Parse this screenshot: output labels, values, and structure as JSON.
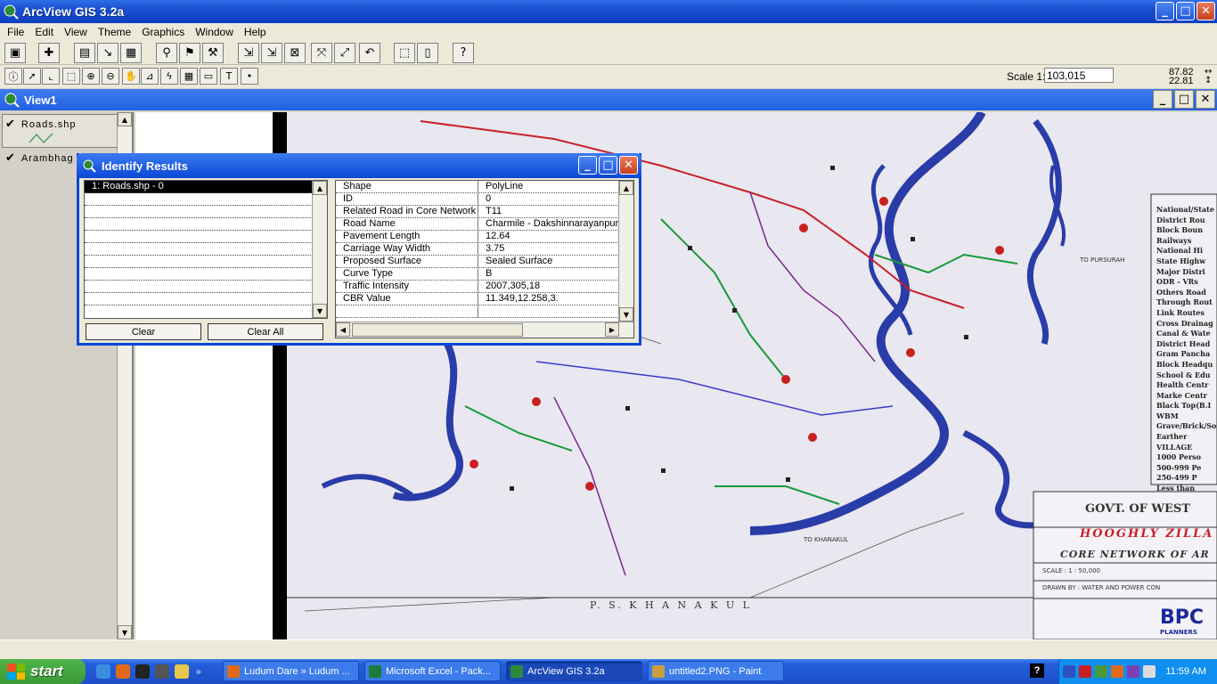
{
  "app": {
    "title": "ArcView GIS 3.2a"
  },
  "menu": [
    "File",
    "Edit",
    "View",
    "Theme",
    "Graphics",
    "Window",
    "Help"
  ],
  "scale": {
    "label": "Scale 1:",
    "value": "103,015"
  },
  "coords": {
    "x": "87.82",
    "y": "22.81"
  },
  "view": {
    "title": "View1"
  },
  "toc": [
    {
      "label": "Roads.shp",
      "checked": true
    },
    {
      "label": "Arambhag",
      "checked": true
    }
  ],
  "identify": {
    "title": "Identify Results",
    "results": [
      "1:  Roads.shp - 0"
    ],
    "attributes": [
      {
        "key": "Shape",
        "value": "PolyLine"
      },
      {
        "key": "ID",
        "value": "0"
      },
      {
        "key": "Related Road in Core Network",
        "value": "T11"
      },
      {
        "key": "Road Name",
        "value": "Charmile - Dakshinnarayanpur"
      },
      {
        "key": "Pavement Length",
        "value": "12.64"
      },
      {
        "key": "Carriage Way Width",
        "value": "3.75"
      },
      {
        "key": "Proposed Surface",
        "value": "Sealed Surface"
      },
      {
        "key": "Curve Type",
        "value": "B"
      },
      {
        "key": "Traffic Intensity",
        "value": "2007,305,18"
      },
      {
        "key": "CBR Value",
        "value": "11.349,12.258,3."
      }
    ],
    "clear_label": "Clear",
    "clear_all_label": "Clear All"
  },
  "map": {
    "labels": {
      "govt": "GOVT. OF WEST",
      "zilla": "HOOGHLY ZILLA",
      "core": "CORE NETWORK OF AR",
      "scale_txt": "SCALE : 1 : 50,000",
      "drawn": "DRAWN BY : WATER AND POWER CON",
      "bottom": "P. S.  K H A N A K U L",
      "pursurah": "TO PURSURAH",
      "khanakul": "TO KHANAKUL",
      "bpc": "BPC",
      "planners": "PLANNERS"
    },
    "legend": [
      "National/State",
      "District Rou",
      "Block Boun",
      "Railways",
      "National Hi",
      "State Highw",
      "Major Distri",
      "ODR - VRs",
      "Others Road",
      "Through Rout",
      "Link Routes",
      "Cross Drainag",
      "Canal & Wate",
      "District Head",
      "Gram Pancha",
      "Block Headqu",
      "School & Edu",
      "Health Centr",
      "Marke Centr",
      "Black Top(B.I",
      "WBM",
      "Grave/Brick/Soli",
      "Earther",
      "VILLAGE",
      "1000 Perso",
      "500-999 Pe",
      "250-499 P",
      "Less than"
    ]
  },
  "taskbar": {
    "start": "start",
    "tasks": [
      "Ludum Dare » Ludum ...",
      "Microsoft Excel - Pack...",
      "ArcView GIS 3.2a",
      "untitled2.PNG - Paint"
    ],
    "clock": "11:59 AM"
  }
}
